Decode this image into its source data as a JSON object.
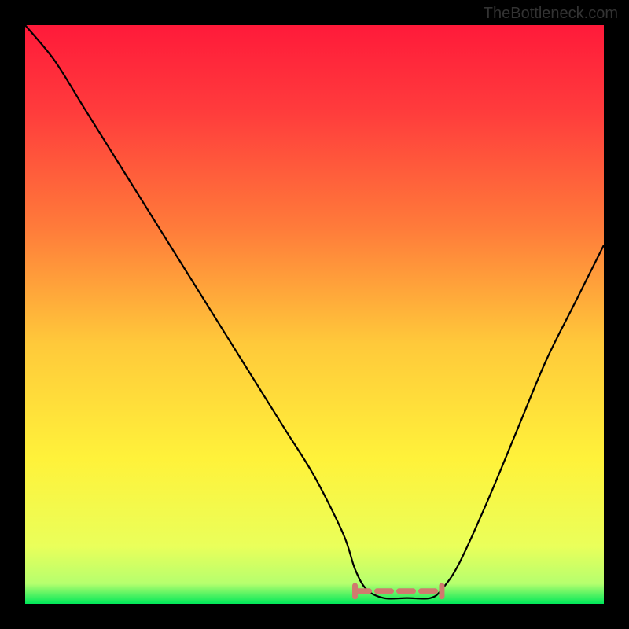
{
  "watermark": "TheBottleneck.com",
  "chart_data": {
    "type": "line",
    "title": "",
    "xlabel": "",
    "ylabel": "",
    "xlim": [
      0,
      100
    ],
    "ylim": [
      0,
      100
    ],
    "background_gradient": {
      "type": "vertical",
      "stops": [
        {
          "pos": 0.0,
          "color": "#ff1a3a"
        },
        {
          "pos": 0.15,
          "color": "#ff3c3c"
        },
        {
          "pos": 0.35,
          "color": "#ff7b3a"
        },
        {
          "pos": 0.55,
          "color": "#ffc93a"
        },
        {
          "pos": 0.75,
          "color": "#fff23a"
        },
        {
          "pos": 0.9,
          "color": "#eaff5a"
        },
        {
          "pos": 0.965,
          "color": "#b6ff6e"
        },
        {
          "pos": 1.0,
          "color": "#00e85a"
        }
      ]
    },
    "curve": {
      "x": [
        0,
        5,
        10,
        15,
        20,
        25,
        30,
        35,
        40,
        45,
        50,
        55,
        57,
        59,
        62,
        66,
        70,
        72,
        75,
        80,
        85,
        90,
        95,
        100
      ],
      "y": [
        100,
        94,
        86,
        78,
        70,
        62,
        54,
        46,
        38,
        30,
        22,
        12,
        6,
        2.5,
        1.0,
        1.0,
        1.0,
        2.5,
        7,
        18,
        30,
        42,
        52,
        62
      ]
    },
    "valley_marker": {
      "x_start": 57,
      "x_end": 72,
      "y": 2.2,
      "color": "#d07a6e",
      "dash": [
        18,
        10
      ]
    }
  }
}
